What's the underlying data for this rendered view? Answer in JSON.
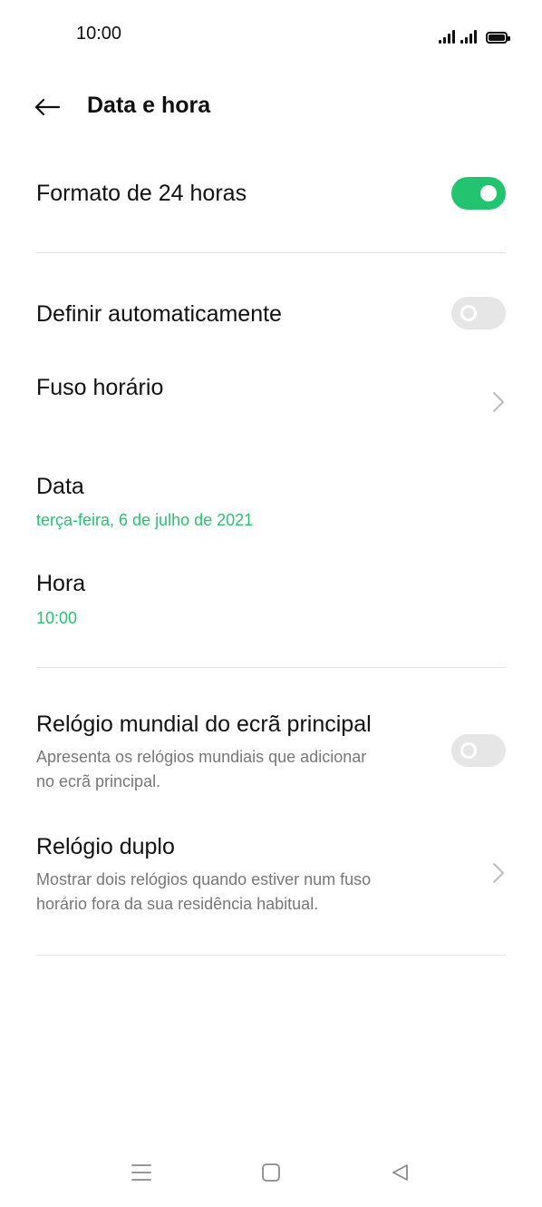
{
  "status_bar": {
    "time": "10:00"
  },
  "header": {
    "title": "Data e hora"
  },
  "accent_color": "#23c46f",
  "settings": {
    "format24": {
      "label": "Formato de 24 horas",
      "toggle_on": true
    },
    "auto_set": {
      "label": "Definir automaticamente",
      "toggle_on": false
    },
    "timezone": {
      "label": "Fuso horário"
    },
    "date": {
      "label": "Data",
      "value": "terça-feira, 6 de julho de 2021"
    },
    "time": {
      "label": "Hora",
      "value": "10:00"
    },
    "world_clock": {
      "label": "Relógio mundial do ecrã principal",
      "desc_line1": "Apresenta os relógios mundiais que adicionar",
      "desc_line2": "no ecrã principal.",
      "toggle_on": false
    },
    "dual_clock": {
      "label": "Relógio duplo",
      "desc_line1": "Mostrar dois relógios quando estiver num fuso",
      "desc_line2": "horário fora da sua residência habitual."
    }
  },
  "nav_bar": {
    "icons": [
      "menu-icon",
      "home-square-icon",
      "back-triangle-icon"
    ]
  }
}
